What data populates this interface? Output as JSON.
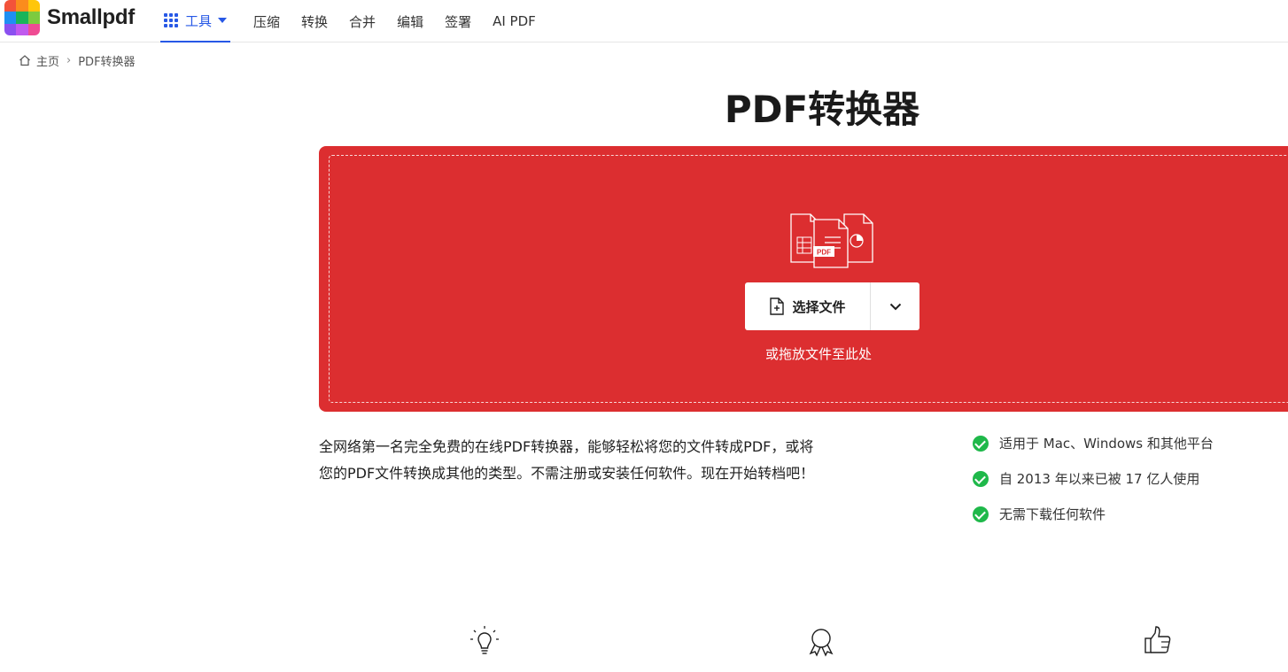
{
  "header": {
    "logo_text": "Smallpdf",
    "tools_label": "工具",
    "nav": [
      "压缩",
      "转换",
      "合并",
      "编辑",
      "签署",
      "AI PDF"
    ]
  },
  "breadcrumb": {
    "home": "主页",
    "current": "PDF转换器"
  },
  "main": {
    "title": "PDF转换器",
    "choose_file": "选择文件",
    "drop_hint": "或拖放文件至此处",
    "illus_badge": "PDF",
    "description_line1": "全网络第一名完全免费的在线PDF转换器，能够轻松将您的文件转成PDF，或将",
    "description_line2": "您的PDF文件转换成其他的类型。不需注册或安装任何软件。现在开始转档吧！",
    "features": [
      "适用于 Mac、Windows 和其他平台",
      "自 2013 年以来已被 17 亿人使用",
      "无需下载任何软件"
    ]
  },
  "colors": {
    "accent_blue": "#2758e6",
    "dropzone_red": "#dc2e30",
    "check_green": "#1fb84a"
  },
  "icons": [
    "home-icon",
    "grid-icon",
    "file-plus-icon",
    "chevron-down-icon",
    "check-circle-icon",
    "lightbulb-icon",
    "award-icon",
    "thumbs-up-icon"
  ]
}
